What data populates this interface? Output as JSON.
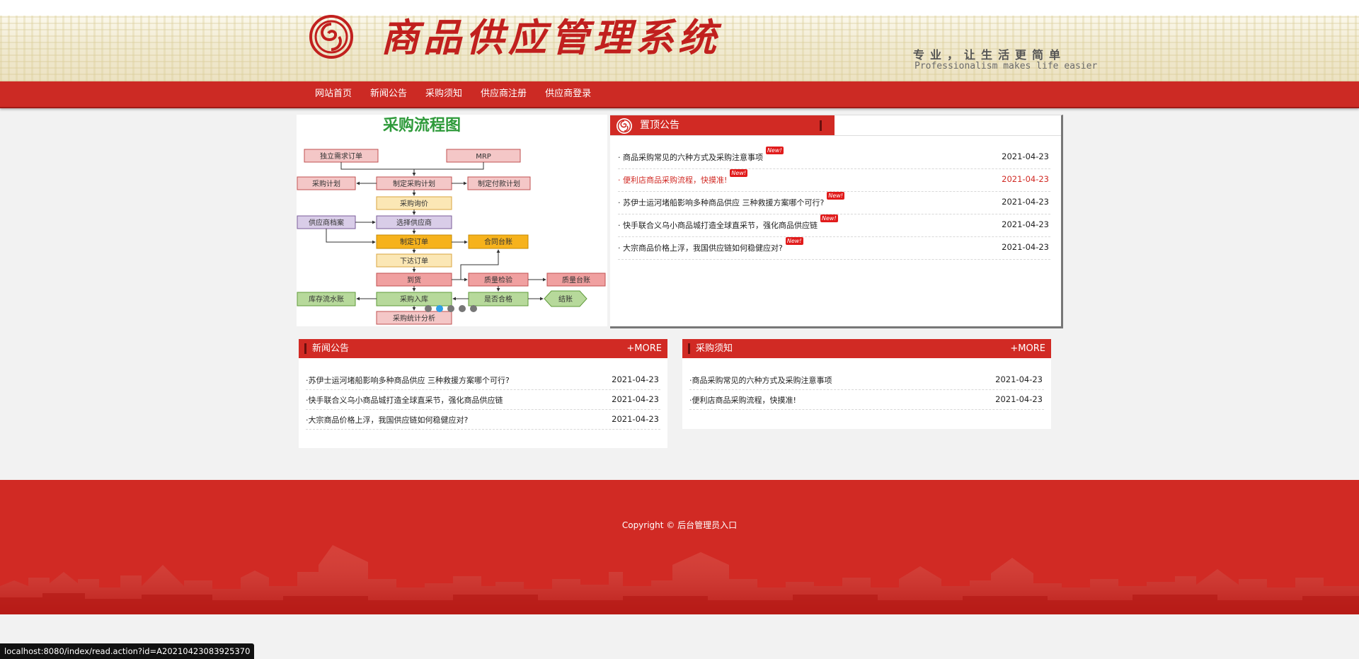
{
  "header": {
    "site_title": "商品供应管理系统",
    "slogan_cn": "专业，让生活更简单",
    "slogan_en": "Professionalism makes life easier"
  },
  "nav": {
    "items": [
      "网站首页",
      "新闻公告",
      "采购须知",
      "供应商注册",
      "供应商登录"
    ]
  },
  "slider": {
    "chart_title": "采购流程图",
    "nodes": {
      "indep_demand": "独立需求订单",
      "mrp": "MRP",
      "purchase_plan": "采购计划",
      "make_plan": "制定采购计划",
      "payment_plan": "制定付款计划",
      "inquiry": "采购询价",
      "supplier_archive": "供应商档案",
      "select_supplier": "选择供应商",
      "make_order": "制定订单",
      "contract_ledger": "合同台账",
      "issue_order": "下达订单",
      "arrival": "到货",
      "quality_check": "质量检验",
      "quality_ledger": "质量台账",
      "inventory_ledger": "库存流水账",
      "warehouse_in": "采购入库",
      "qualified": "是否合格",
      "settlement": "结账",
      "stats": "采购统计分析"
    },
    "active_dot": 2,
    "dot_count": 5
  },
  "top_notices": {
    "title": "置顶公告",
    "badge": "New!",
    "items": [
      {
        "title": "· 商品采购常见的六种方式及采购注意事项",
        "date": "2021-04-23",
        "highlight": false
      },
      {
        "title": "· 便利店商品采购流程，快摸准!",
        "date": "2021-04-23",
        "highlight": true
      },
      {
        "title": "· 苏伊士运河堵船影响多种商品供应 三种救援方案哪个可行?",
        "date": "2021-04-23",
        "highlight": false
      },
      {
        "title": "· 快手联合义乌小商品城打造全球直采节，强化商品供应链",
        "date": "2021-04-23",
        "highlight": false
      },
      {
        "title": "· 大宗商品价格上浮，我国供应链如何稳健应对?",
        "date": "2021-04-23",
        "highlight": false
      }
    ]
  },
  "news_box": {
    "title": "新闻公告",
    "more": "+MORE",
    "items": [
      {
        "title": "·苏伊士运河堵船影响多种商品供应 三种救援方案哪个可行?",
        "date": "2021-04-23"
      },
      {
        "title": "·快手联合义乌小商品城打造全球直采节，强化商品供应链",
        "date": "2021-04-23"
      },
      {
        "title": "·大宗商品价格上浮，我国供应链如何稳健应对?",
        "date": "2021-04-23"
      }
    ]
  },
  "purchase_box": {
    "title": "采购须知",
    "more": "+MORE",
    "items": [
      {
        "title": "·商品采购常见的六种方式及采购注意事项",
        "date": "2021-04-23"
      },
      {
        "title": "·便利店商品采购流程，快摸准!",
        "date": "2021-04-23"
      }
    ]
  },
  "footer": {
    "copyright_prefix": "Copyright ©",
    "admin_link": "后台管理员入口"
  },
  "statusbar": {
    "url": "localhost:8080/index/read.action?id=A20210423083925370"
  },
  "colors": {
    "brand_red": "#cc2a24",
    "link_highlight": "#d12a24",
    "active_dot": "#2fa0e6"
  }
}
